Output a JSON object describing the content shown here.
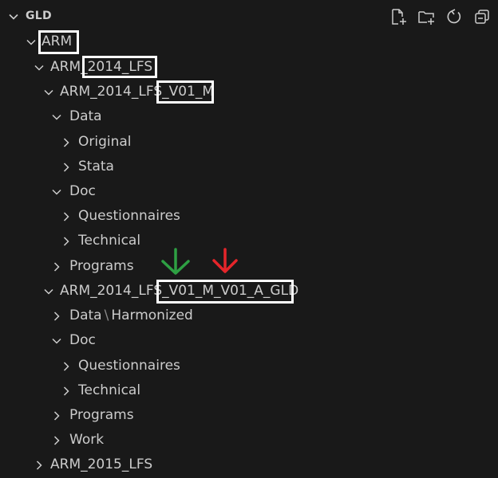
{
  "explorer": {
    "title": "GLD",
    "actions": {
      "new_file": "new-file-icon",
      "new_folder": "new-folder-icon",
      "refresh": "refresh-icon",
      "collapse_all": "collapse-all-icon"
    }
  },
  "tree": [
    {
      "label": "ARM",
      "expanded": true
    },
    {
      "label": "ARM_2014_LFS",
      "expanded": true
    },
    {
      "label": "ARM_2014_LFS_V01_M",
      "expanded": true
    },
    {
      "label": "Data",
      "expanded": true
    },
    {
      "label": "Original",
      "expanded": false
    },
    {
      "label": "Stata",
      "expanded": false
    },
    {
      "label": "Doc",
      "expanded": true
    },
    {
      "label": "Questionnaires",
      "expanded": false
    },
    {
      "label": "Technical",
      "expanded": false
    },
    {
      "label": "Programs",
      "expanded": false
    },
    {
      "label": "ARM_2014_LFS_V01_M_V01_A_GLD",
      "expanded": true
    },
    {
      "label_a": "Data",
      "sep": "\\",
      "label_b": "Harmonized",
      "expanded": false
    },
    {
      "label": "Doc",
      "expanded": true
    },
    {
      "label": "Questionnaires",
      "expanded": false
    },
    {
      "label": "Technical",
      "expanded": false
    },
    {
      "label": "Programs",
      "expanded": false
    },
    {
      "label": "Work",
      "expanded": false
    },
    {
      "label": "ARM_2015_LFS",
      "expanded": false
    }
  ],
  "colors": {
    "background": "#191919",
    "text": "#cccccc",
    "highlight_box": "#ffffff",
    "green_arrow": "#2ea043",
    "red_arrow": "#e5252a"
  }
}
